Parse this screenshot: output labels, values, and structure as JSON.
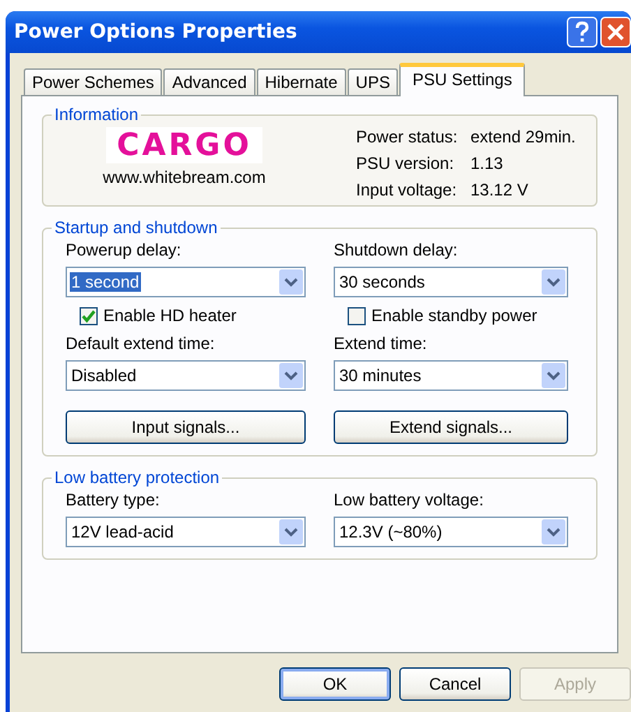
{
  "window": {
    "title": "Power Options Properties"
  },
  "tabs": [
    {
      "label": "Power Schemes",
      "selected": false
    },
    {
      "label": "Advanced",
      "selected": false
    },
    {
      "label": "Hibernate",
      "selected": false
    },
    {
      "label": "UPS",
      "selected": false
    },
    {
      "label": "PSU Settings",
      "selected": true
    }
  ],
  "information": {
    "title": "Information",
    "logo": "CARGO",
    "website": "www.whitebream.com",
    "rows": [
      {
        "label": "Power status:",
        "value": "extend 29min."
      },
      {
        "label": "PSU version:",
        "value": "1.13"
      },
      {
        "label": "Input voltage:",
        "value": "13.12 V"
      }
    ]
  },
  "startup": {
    "title": "Startup and shutdown",
    "combos": [
      {
        "label": "Powerup delay:",
        "value": "1 second",
        "focused": true
      },
      {
        "label": "Shutdown delay:",
        "value": "30 seconds",
        "focused": false
      }
    ],
    "checkboxes": [
      {
        "label": "Enable HD heater",
        "checked": true
      },
      {
        "label": "Enable standby power",
        "checked": false
      }
    ],
    "combos2": [
      {
        "label": "Default extend time:",
        "value": "Disabled",
        "focused": false
      },
      {
        "label": "Extend time:",
        "value": "30 minutes",
        "focused": false
      }
    ],
    "buttons": [
      {
        "label": "Input signals..."
      },
      {
        "label": "Extend signals..."
      }
    ]
  },
  "low_battery": {
    "title": "Low battery protection",
    "combos": [
      {
        "label": "Battery type:",
        "value": "12V lead-acid",
        "focused": false
      },
      {
        "label": "Low battery voltage:",
        "value": "12.3V (~80%)",
        "focused": false
      }
    ]
  },
  "buttons": [
    {
      "label": "OK",
      "default": true,
      "disabled": false
    },
    {
      "label": "Cancel",
      "default": false,
      "disabled": false
    },
    {
      "label": "Apply",
      "default": false,
      "disabled": true
    }
  ]
}
